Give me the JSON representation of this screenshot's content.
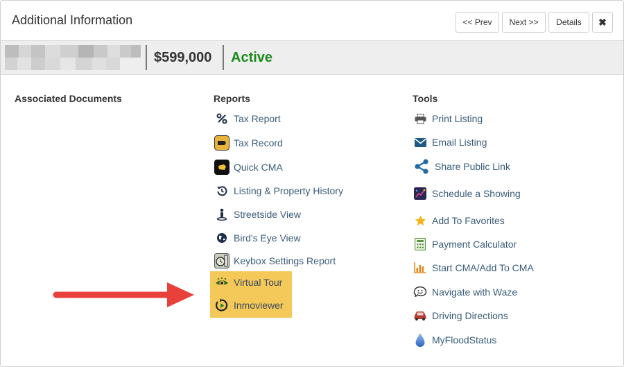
{
  "header": {
    "title": "Additional Information",
    "prev_label": "<< Prev",
    "next_label": "Next >>",
    "details_label": "Details",
    "close_label": "✖"
  },
  "listing": {
    "price": "$599,000",
    "status": "Active",
    "status_color": "#1d8a1d"
  },
  "columns": {
    "documents": {
      "title": "Associated Documents",
      "items": []
    },
    "reports": {
      "title": "Reports",
      "items": [
        {
          "label": "Tax Report",
          "icon": "percent-icon"
        },
        {
          "label": "Tax Record",
          "icon": "tax-record-icon"
        },
        {
          "label": "Quick CMA",
          "icon": "quick-cma-icon"
        },
        {
          "label": "Listing & Property History",
          "icon": "history-icon"
        },
        {
          "label": "Streetside View",
          "icon": "street-person-icon"
        },
        {
          "label": "Bird's Eye View",
          "icon": "globe-icon"
        },
        {
          "label": "Keybox Settings Report",
          "icon": "keybox-icon"
        },
        {
          "label": "Virtual Tour",
          "icon": "eye-icon"
        },
        {
          "label": "Inmoviewer",
          "icon": "play-replay-icon"
        }
      ]
    },
    "tools": {
      "title": "Tools",
      "items": [
        {
          "label": "Print Listing",
          "icon": "printer-icon"
        },
        {
          "label": "Email Listing",
          "icon": "envelope-icon"
        },
        {
          "label": "Share Public Link",
          "icon": "share-icon"
        },
        {
          "label": "Schedule a Showing",
          "icon": "calendar-icon"
        },
        {
          "label": "Add To Favorites",
          "icon": "star-icon"
        },
        {
          "label": "Payment Calculator",
          "icon": "calculator-icon"
        },
        {
          "label": "Start CMA/Add To CMA",
          "icon": "bar-chart-icon"
        },
        {
          "label": "Navigate with Waze",
          "icon": "waze-icon"
        },
        {
          "label": "Driving Directions",
          "icon": "car-icon"
        },
        {
          "label": "MyFloodStatus",
          "icon": "water-drop-icon"
        }
      ]
    }
  },
  "colors": {
    "link": "#3a5c7a",
    "highlight": "#f5c85a",
    "arrow": "#e8413c",
    "bar_background": "#eeeeee"
  }
}
